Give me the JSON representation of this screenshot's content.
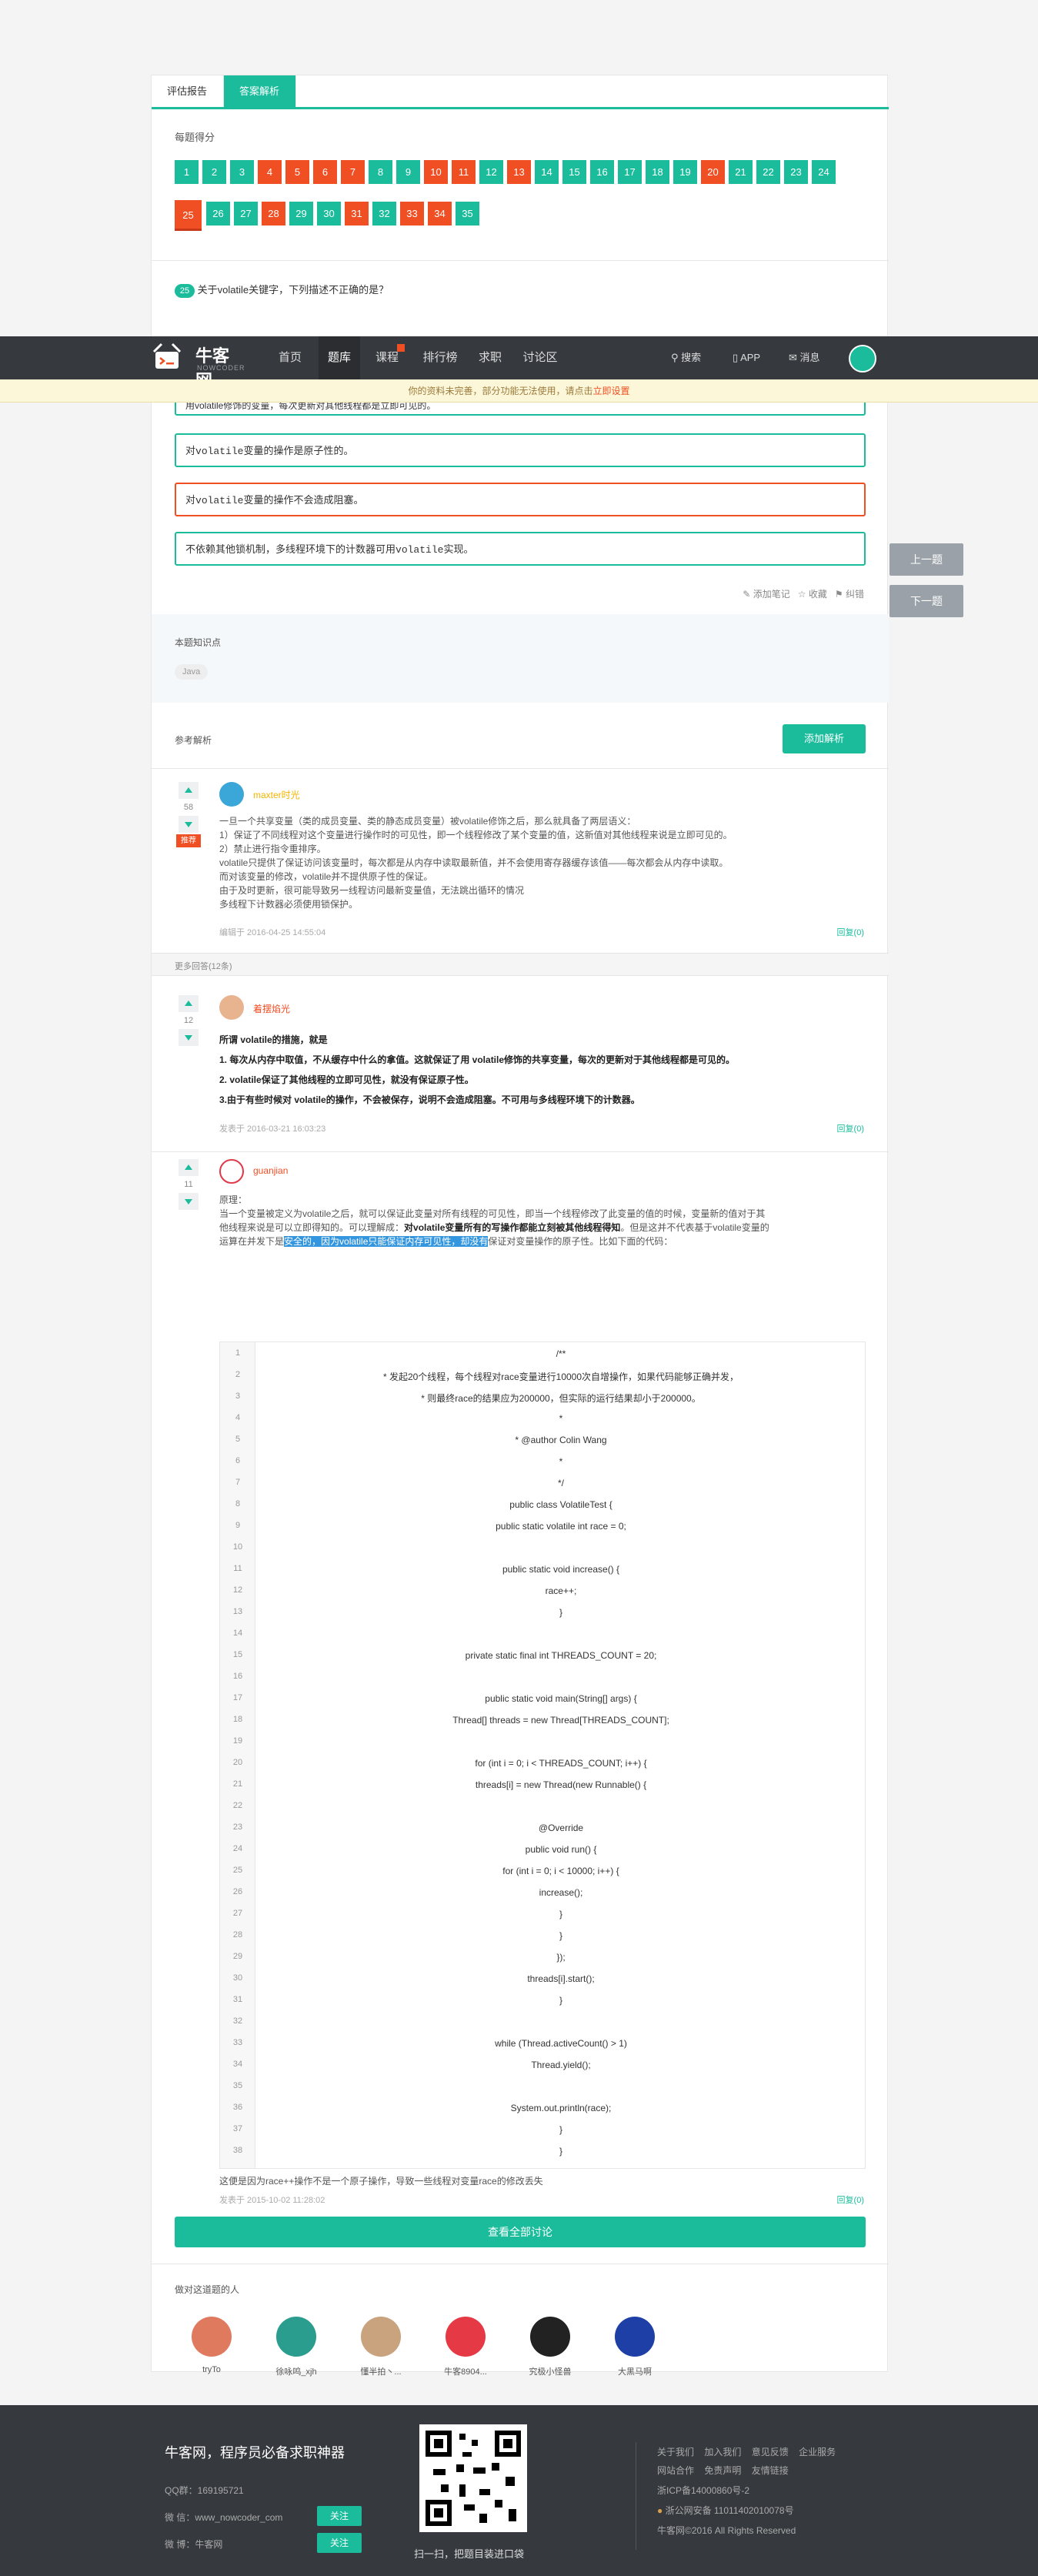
{
  "tabs": {
    "report": "评估报告",
    "analysis": "答案解析"
  },
  "score_title": "每题得分",
  "cells_row1": [
    {
      "n": "1",
      "s": "ok"
    },
    {
      "n": "2",
      "s": "ok"
    },
    {
      "n": "3",
      "s": "ok"
    },
    {
      "n": "4",
      "s": "bad"
    },
    {
      "n": "5",
      "s": "bad"
    },
    {
      "n": "6",
      "s": "bad"
    },
    {
      "n": "7",
      "s": "bad"
    },
    {
      "n": "8",
      "s": "ok"
    },
    {
      "n": "9",
      "s": "ok"
    },
    {
      "n": "10",
      "s": "bad"
    },
    {
      "n": "11",
      "s": "bad"
    },
    {
      "n": "12",
      "s": "ok"
    },
    {
      "n": "13",
      "s": "bad"
    },
    {
      "n": "14",
      "s": "ok"
    },
    {
      "n": "15",
      "s": "ok"
    },
    {
      "n": "16",
      "s": "ok"
    },
    {
      "n": "17",
      "s": "ok"
    },
    {
      "n": "18",
      "s": "ok"
    },
    {
      "n": "19",
      "s": "ok"
    },
    {
      "n": "20",
      "s": "bad"
    },
    {
      "n": "21",
      "s": "ok"
    },
    {
      "n": "22",
      "s": "ok"
    },
    {
      "n": "23",
      "s": "ok"
    },
    {
      "n": "24",
      "s": "ok"
    }
  ],
  "cells_row2": [
    {
      "n": "25",
      "s": "bad"
    },
    {
      "n": "26",
      "s": "ok"
    },
    {
      "n": "27",
      "s": "ok"
    },
    {
      "n": "28",
      "s": "bad"
    },
    {
      "n": "29",
      "s": "ok"
    },
    {
      "n": "30",
      "s": "ok"
    },
    {
      "n": "31",
      "s": "bad"
    },
    {
      "n": "32",
      "s": "ok"
    },
    {
      "n": "33",
      "s": "bad"
    },
    {
      "n": "34",
      "s": "bad"
    },
    {
      "n": "35",
      "s": "ok"
    }
  ],
  "question": {
    "num": "25",
    "text": "关于volatile关键字，下列描述不正确的是？"
  },
  "nav": {
    "brand": "牛客网",
    "brand_sub": "NOWCODER",
    "items": [
      "首页",
      "题库",
      "课程",
      "排行榜",
      "求职",
      "讨论区"
    ],
    "search": "搜索",
    "app": "APP",
    "msg": "消息"
  },
  "notice": {
    "text": "你的资料未完善，部分功能无法使用，请点击",
    "link": "立即设置"
  },
  "options_partial": "用volatile修饰的变量，每次更新对其他线程都是立即可见的。",
  "options": [
    {
      "pre": "对",
      "code": "volatile",
      "post": "变量的操作是原子性的。",
      "c": "g"
    },
    {
      "pre": "对",
      "code": "volatile",
      "post": "变量的操作不会造成阻塞。",
      "c": "r"
    },
    {
      "pre": "不依赖其他锁机制，多线程环境下的计数器可用",
      "code": "volatile",
      "post": "实现。",
      "c": "g"
    }
  ],
  "actions": {
    "note": "添加笔记",
    "fav": "收藏",
    "err": "纠错"
  },
  "side": {
    "prev": "上一题",
    "next": "下一题"
  },
  "kp": {
    "title": "本题知识点",
    "tag": "Java"
  },
  "ref": {
    "title": "参考解析",
    "add": "添加解析"
  },
  "a1": {
    "votes": "58",
    "rec": "推荐",
    "user": "maxter时光",
    "lines": [
      "一旦一个共享变量（类的成员变量、类的静态成员变量）被volatile修饰之后，那么就具备了两层语义：",
      "1）保证了不同线程对这个变量进行操作时的可见性，即一个线程修改了某个变量的值，这新值对其他线程来说是立即可见的。",
      "2）禁止进行指令重排序。",
      "volatile只提供了保证访问该变量时，每次都是从内存中读取最新值，并不会使用寄存器缓存该值——每次都会从内存中读取。",
      "而对该变量的修改，volatile并不提供原子性的保证。",
      "由于及时更新，很可能导致另一线程访问最新变量值，无法跳出循环的情况",
      "多线程下计数器必须使用锁保护。"
    ],
    "meta": "编辑于 2016-04-25 14:55:04",
    "reply": "回复(0)"
  },
  "more": "更多回答(12条)",
  "a2": {
    "votes": "12",
    "user": "着摆焰光",
    "lines": [
      "所谓 volatile的措施，就是",
      "1. 每次从内存中取值，不从缓存中什么的拿值。这就保证了用 volatile修饰的共享变量，每次的更新对于其他线程都是可见的。",
      "2. volatile保证了其他线程的立即可见性，就没有保证原子性。",
      "3.由于有些时候对 volatile的操作，不会被保存，说明不会造成阻塞。不可用与多线程环境下的计数器。"
    ],
    "meta": "发表于 2016-03-21 16:03:23",
    "reply": "回复(0)"
  },
  "a3": {
    "votes": "11",
    "user": "guanjian",
    "l1": "原理：",
    "l2": "当一个变量被定义为volatile之后，就可以保证此变量对所有线程的可见性，即当一个线程修改了此变量的值的时候，变量新的值对于其",
    "l3a": "他线程来说是可以立即得知的。可以理解成：",
    "l3b": "对volatile变量所有的写操作都能立刻被其他线程得知",
    "l3c": "。但是这并不代表基于volatile变量的",
    "l4a": "运算在并发下是",
    "l4b": "安全的，因为volatile只能保证内存可见性，却没有",
    "l4c": "保证对变量操作的原子性。比如下面的代码：",
    "code": [
      "/**",
      " * 发起20个线程，每个线程对race变量进行10000次自增操作，如果代码能够正确并发，",
      " * 则最终race的结果应为200000，但实际的运行结果却小于200000。",
      " *",
      " * @author Colin Wang",
      " *",
      " */",
      "public class VolatileTest {",
      "public static volatile int race = 0;",
      "",
      "public static void increase() {",
      "race++;",
      "}",
      "",
      "private static final int THREADS_COUNT = 20;",
      "",
      "public static void main(String[] args) {",
      "Thread[] threads = new Thread[THREADS_COUNT];",
      "",
      "for (int i = 0; i < THREADS_COUNT; i++) {",
      "threads[i] = new Thread(new Runnable() {",
      "",
      "@Override",
      "public void run() {",
      "for (int i = 0; i < 10000; i++) {",
      "increase();",
      "}",
      "}",
      "});",
      "threads[i].start();",
      "}",
      "",
      "while (Thread.activeCount() > 1)",
      "Thread.yield();",
      "",
      "System.out.println(race);",
      "}",
      "}"
    ],
    "after": "这便是因为race++操作不是一个原子操作，导致一些线程对变量race的修改丢失",
    "meta": "发表于 2015-10-02 11:28:02",
    "reply": "回复(0)"
  },
  "view_all": "查看全部讨论",
  "people": {
    "title": "做对这道题的人",
    "names": [
      "tryTo",
      "徐咏鸣_xjh",
      "懂半拍丶...",
      "牛客8904...",
      "究极小怪兽",
      "大黑马啊"
    ]
  },
  "footer": {
    "slogan": "牛客网，程序员必备求职神器",
    "qq": "QQ群：169195721",
    "wx": "微 信：www_nowcoder_com",
    "wb": "微 博：牛客网",
    "follow": "关注",
    "scan": "扫一扫，把题目装进口袋",
    "links1": [
      "关于我们",
      "加入我们",
      "意见反馈",
      "企业服务"
    ],
    "links2": [
      "网站合作",
      "免责声明",
      "友情链接"
    ],
    "icp": "浙ICP备14000860号-2",
    "police": "浙公网安备 11011402010078号",
    "copy": "牛客网©2016 All Rights Reserved"
  }
}
